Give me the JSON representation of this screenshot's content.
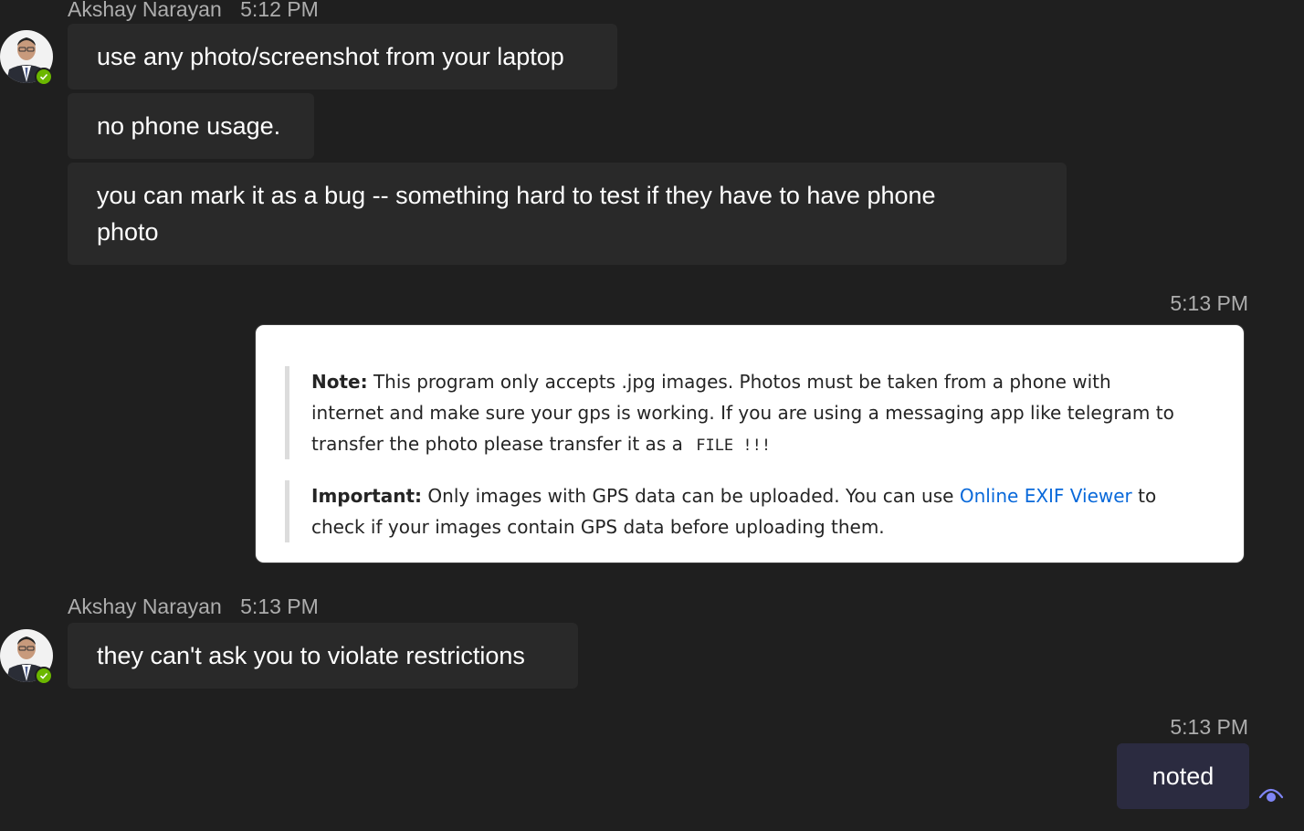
{
  "group1": {
    "sender": "Akshay Narayan",
    "time": "5:12 PM",
    "messages": [
      "use any photo/screenshot from your laptop",
      "no phone usage.",
      "you can mark it as a bug -- something hard to test if they have to have phone photo"
    ]
  },
  "shared_image": {
    "time": "5:13 PM",
    "note_label": "Note:",
    "note_text": "This program only accepts .jpg images. Photos must be taken from a phone with internet and make sure your gps is working. If you are using a messaging app like telegram to transfer the photo please transfer it as a",
    "note_code": "FILE !!!",
    "important_label": "Important:",
    "important_text_before": "Only images with GPS data can be uploaded. You can use",
    "important_link": "Online EXIF Viewer",
    "important_text_after": "to check if your images contain GPS data before uploading them."
  },
  "group2": {
    "sender": "Akshay Narayan",
    "time": "5:13 PM",
    "messages": [
      "they can't ask you to violate restrictions"
    ]
  },
  "own_message": {
    "time": "5:13 PM",
    "text": "noted"
  },
  "icons": {
    "presence": "available-check-icon",
    "seen": "seen-eye-icon"
  },
  "colors": {
    "background": "#1f1f1f",
    "bubble": "#292929",
    "own_bubble": "#2b2b40",
    "presence": "#6bb700",
    "link": "#0969da",
    "seen": "#7f85f5"
  }
}
